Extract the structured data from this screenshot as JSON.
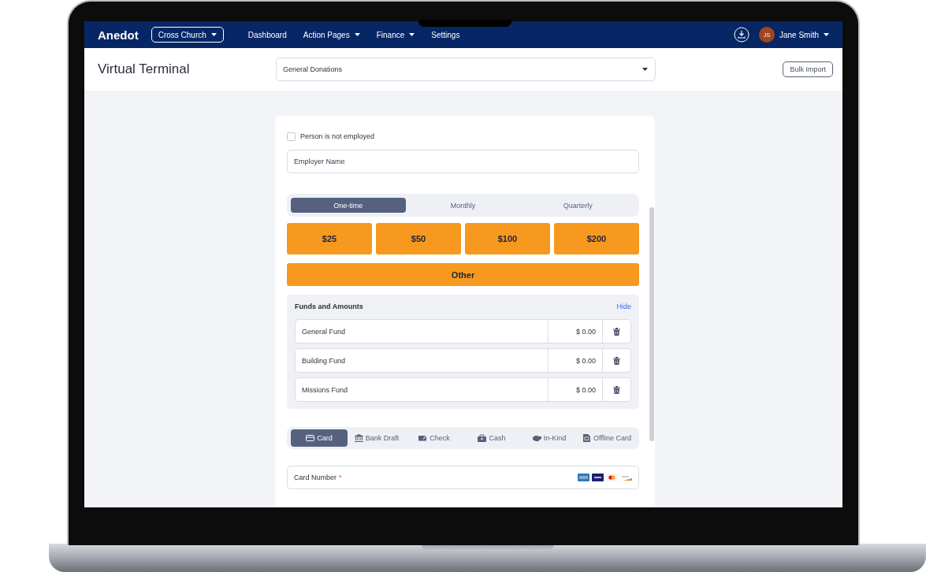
{
  "nav": {
    "logo": "Anedot",
    "org_switcher": "Cross Church",
    "menu": [
      {
        "label": "Dashboard",
        "dropdown": false
      },
      {
        "label": "Action Pages",
        "dropdown": true
      },
      {
        "label": "Finance",
        "dropdown": true
      },
      {
        "label": "Settings",
        "dropdown": false
      }
    ],
    "user": {
      "initials": "JS",
      "name": "Jane Smith"
    }
  },
  "header": {
    "title": "Virtual Terminal",
    "page_select": "General Donations",
    "button": "Bulk Import"
  },
  "form": {
    "employment": {
      "label": "Person is not employed",
      "checked": false
    },
    "employer": {
      "placeholder": "Employer Name"
    },
    "frequencies": [
      {
        "label": "One-time",
        "selected": true
      },
      {
        "label": "Monthly",
        "selected": false
      },
      {
        "label": "Quarterly",
        "selected": false
      }
    ],
    "amounts": [
      {
        "label": "$25"
      },
      {
        "label": "$50"
      },
      {
        "label": "$100"
      },
      {
        "label": "$200"
      }
    ],
    "other": "Other",
    "funds": {
      "title": "Funds and Amounts",
      "toggle": "Hide",
      "rows": [
        {
          "name": "General Fund",
          "amount": "$ 0.00"
        },
        {
          "name": "Building Fund",
          "amount": "$ 0.00"
        },
        {
          "name": "Missions Fund",
          "amount": "$ 0.00"
        }
      ]
    },
    "payment_methods": [
      {
        "label": "Card",
        "kind": "card",
        "selected": true
      },
      {
        "label": "Bank Draft",
        "kind": "bank",
        "selected": false
      },
      {
        "label": "Check",
        "kind": "check",
        "selected": false
      },
      {
        "label": "Cash",
        "kind": "cash",
        "selected": false
      },
      {
        "label": "In-Kind",
        "kind": "inkind",
        "selected": false
      },
      {
        "label": "Offline Card",
        "kind": "offline",
        "selected": false
      }
    ],
    "card_number": {
      "label": "Card Number",
      "required_mark": "*"
    }
  }
}
